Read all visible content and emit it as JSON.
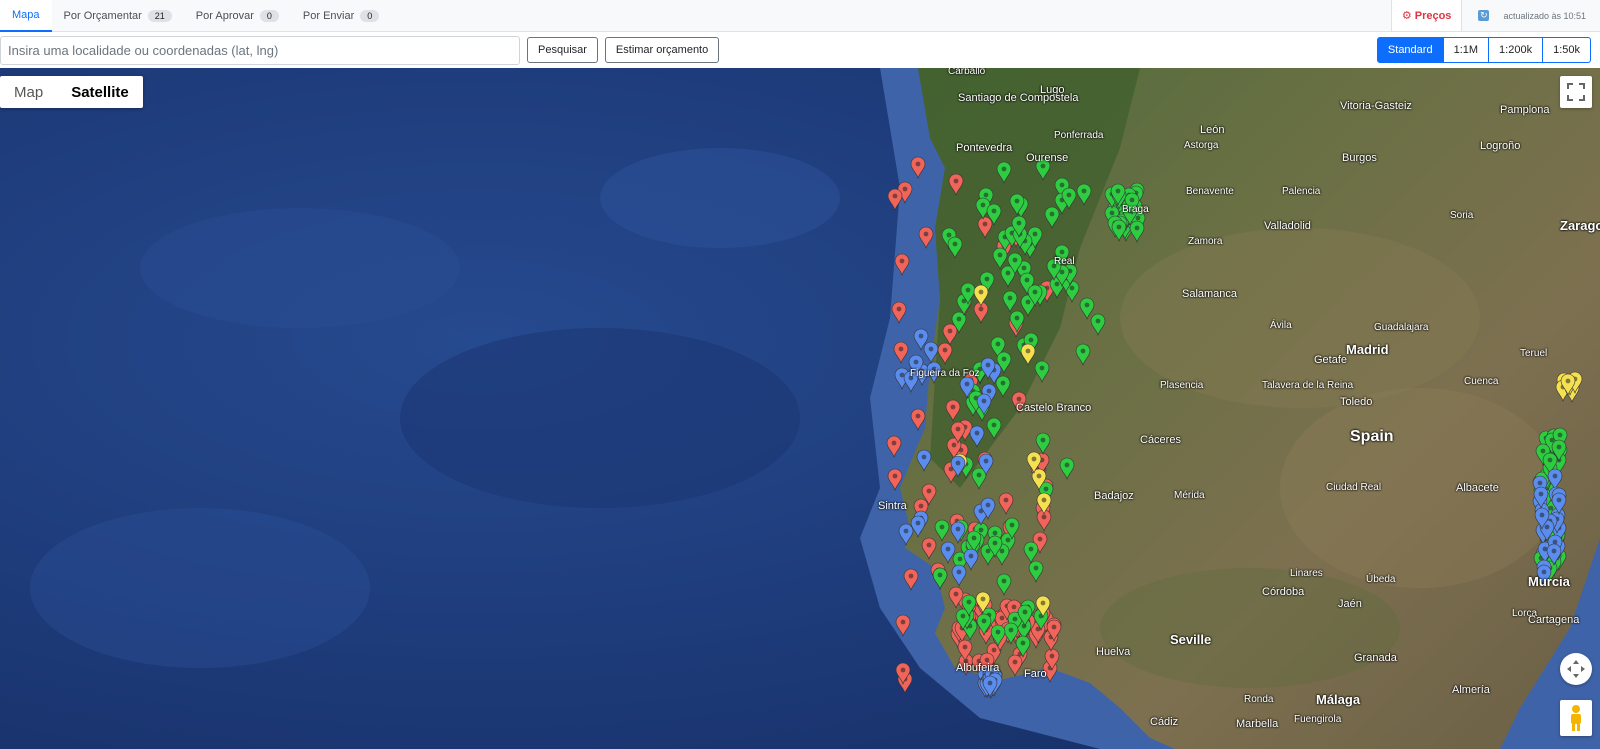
{
  "tabs": [
    {
      "label": "Mapa",
      "badge": null,
      "active": true
    },
    {
      "label": "Por Orçamentar",
      "badge": "21",
      "active": false
    },
    {
      "label": "Por Aprovar",
      "badge": "0",
      "active": false
    },
    {
      "label": "Por Enviar",
      "badge": "0",
      "active": false
    }
  ],
  "header": {
    "prices_label": "Preços",
    "updated_text": "actualizado às 10:51"
  },
  "search": {
    "placeholder": "Insira uma localidade ou coordenadas (lat, lng)",
    "search_button": "Pesquisar",
    "estimate_button": "Estimar orçamento"
  },
  "scales": [
    {
      "label": "Standard",
      "active": true
    },
    {
      "label": "1:1M",
      "active": false
    },
    {
      "label": "1:200k",
      "active": false
    },
    {
      "label": "1:50k",
      "active": false
    }
  ],
  "map_type": {
    "map_label": "Map",
    "satellite_label": "Satellite",
    "active": "Satellite"
  },
  "colors": {
    "accent": "#0d6efd",
    "prices": "#dc3545",
    "marker_green": "#2ecc40",
    "marker_red": "#f0645a",
    "marker_blue": "#5b8def",
    "marker_yellow": "#f5e050"
  },
  "map_labels": [
    {
      "text": "Carballo",
      "cls": "small"
    },
    {
      "text": "Lugo",
      "cls": ""
    },
    {
      "text": "Santiago de Compostela",
      "cls": ""
    },
    {
      "text": "Ponferrada",
      "cls": "small"
    },
    {
      "text": "León",
      "cls": ""
    },
    {
      "text": "Vitoria-Gasteiz",
      "cls": ""
    },
    {
      "text": "Pamplona",
      "cls": ""
    },
    {
      "text": "Pontevedra",
      "cls": ""
    },
    {
      "text": "Ourense",
      "cls": ""
    },
    {
      "text": "Astorga",
      "cls": "small"
    },
    {
      "text": "Burgos",
      "cls": ""
    },
    {
      "text": "Logroño",
      "cls": ""
    },
    {
      "text": "Benavente",
      "cls": "small"
    },
    {
      "text": "Palencia",
      "cls": "small"
    },
    {
      "text": "Valladolid",
      "cls": ""
    },
    {
      "text": "Soria",
      "cls": "small"
    },
    {
      "text": "Zamora",
      "cls": "small"
    },
    {
      "text": "Salamanca",
      "cls": ""
    },
    {
      "text": "Ávila",
      "cls": "small"
    },
    {
      "text": "Guadalajara",
      "cls": "small"
    },
    {
      "text": "Getafe",
      "cls": ""
    },
    {
      "text": "Madrid",
      "cls": "mid"
    },
    {
      "text": "Teruel",
      "cls": "small"
    },
    {
      "text": "Plasencia",
      "cls": "small"
    },
    {
      "text": "Talavera de la Reina",
      "cls": "small"
    },
    {
      "text": "Cuenca",
      "cls": "small"
    },
    {
      "text": "Toledo",
      "cls": ""
    },
    {
      "text": "Castelo Branco",
      "cls": ""
    },
    {
      "text": "Cáceres",
      "cls": ""
    },
    {
      "text": "Spain",
      "cls": "big"
    },
    {
      "text": "Badajoz",
      "cls": ""
    },
    {
      "text": "Mérida",
      "cls": "small"
    },
    {
      "text": "Ciudad Real",
      "cls": "small"
    },
    {
      "text": "Albacete",
      "cls": ""
    },
    {
      "text": "Sintra",
      "cls": ""
    },
    {
      "text": "Linares",
      "cls": "small"
    },
    {
      "text": "Úbeda",
      "cls": "small"
    },
    {
      "text": "Córdoba",
      "cls": ""
    },
    {
      "text": "Jaén",
      "cls": ""
    },
    {
      "text": "Murcia",
      "cls": "mid"
    },
    {
      "text": "Lorca",
      "cls": "small"
    },
    {
      "text": "Cartagena",
      "cls": ""
    },
    {
      "text": "Seville",
      "cls": "mid"
    },
    {
      "text": "Granada",
      "cls": ""
    },
    {
      "text": "Huelva",
      "cls": ""
    },
    {
      "text": "Albufeira",
      "cls": ""
    },
    {
      "text": "Faro",
      "cls": ""
    },
    {
      "text": "Almería",
      "cls": ""
    },
    {
      "text": "Ronda",
      "cls": "small"
    },
    {
      "text": "Málaga",
      "cls": "mid"
    },
    {
      "text": "Cádiz",
      "cls": ""
    },
    {
      "text": "Marbella",
      "cls": ""
    },
    {
      "text": "Fuengirola",
      "cls": "small"
    },
    {
      "text": "Zarago",
      "cls": "mid"
    },
    {
      "text": "Figueira da Foz",
      "cls": "small"
    },
    {
      "text": "Braga",
      "cls": "small"
    },
    {
      "text": "Real",
      "cls": "small"
    }
  ],
  "markers": [
    {
      "color": "green",
      "count": 170
    },
    {
      "color": "red",
      "count": 95
    },
    {
      "color": "blue",
      "count": 70
    },
    {
      "color": "yellow",
      "count": 14
    }
  ]
}
